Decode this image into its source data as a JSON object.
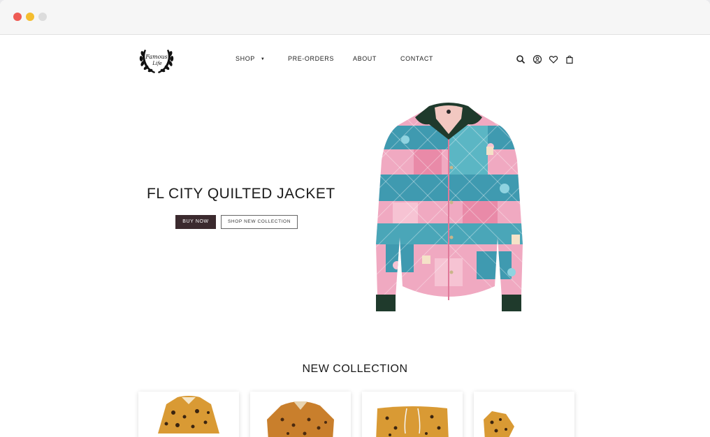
{
  "logo": {
    "line1": "Famous",
    "line2": "Life"
  },
  "nav": {
    "items": [
      {
        "label": "SHOP",
        "has_dropdown": true
      },
      {
        "label": "PRE-ORDERS"
      },
      {
        "label": "ABOUT"
      },
      {
        "label": "CONTACT"
      }
    ]
  },
  "header_icons": [
    "search-icon",
    "account-icon",
    "heart-icon",
    "bag-icon"
  ],
  "hero": {
    "title": "FL CITY QUILTED JACKET",
    "buy_label": "BUY NOW",
    "shop_label": "SHOP NEW COLLECTION"
  },
  "collection": {
    "title": "NEW COLLECTION",
    "products": [
      {
        "name": "leopard-shirt-1"
      },
      {
        "name": "leopard-shirt-2"
      },
      {
        "name": "leopard-shorts"
      },
      {
        "name": "leopard-item"
      }
    ]
  },
  "colors": {
    "button_dark": "#3b2a2e",
    "jacket_pink": "#f0a9c1",
    "jacket_teal": "#3f9ab0",
    "collar_green": "#1f3a2c",
    "leopard": "#d99a34"
  }
}
